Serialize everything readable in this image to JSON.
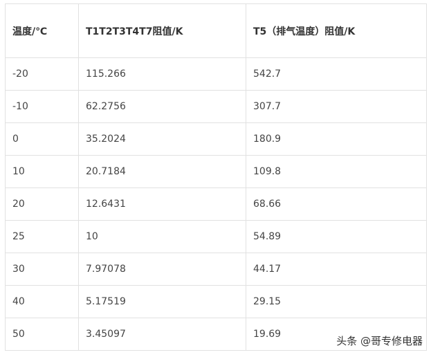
{
  "table": {
    "headers": [
      "温度/℃",
      "T1T2T3T4T7阻值/K",
      "T5（排气温度）阻值/K"
    ],
    "rows": [
      [
        "-20",
        "115.266",
        "542.7"
      ],
      [
        "-10",
        "62.2756",
        "307.7"
      ],
      [
        "0",
        "35.2024",
        "180.9"
      ],
      [
        "10",
        "20.7184",
        "109.8"
      ],
      [
        "20",
        "12.6431",
        "68.66"
      ],
      [
        "25",
        "10",
        "54.89"
      ],
      [
        "30",
        "7.97078",
        "44.17"
      ],
      [
        "40",
        "5.17519",
        "29.15"
      ],
      [
        "50",
        "3.45097",
        "19.69"
      ]
    ]
  },
  "watermark": {
    "text": "头条 @哥专修电器"
  }
}
